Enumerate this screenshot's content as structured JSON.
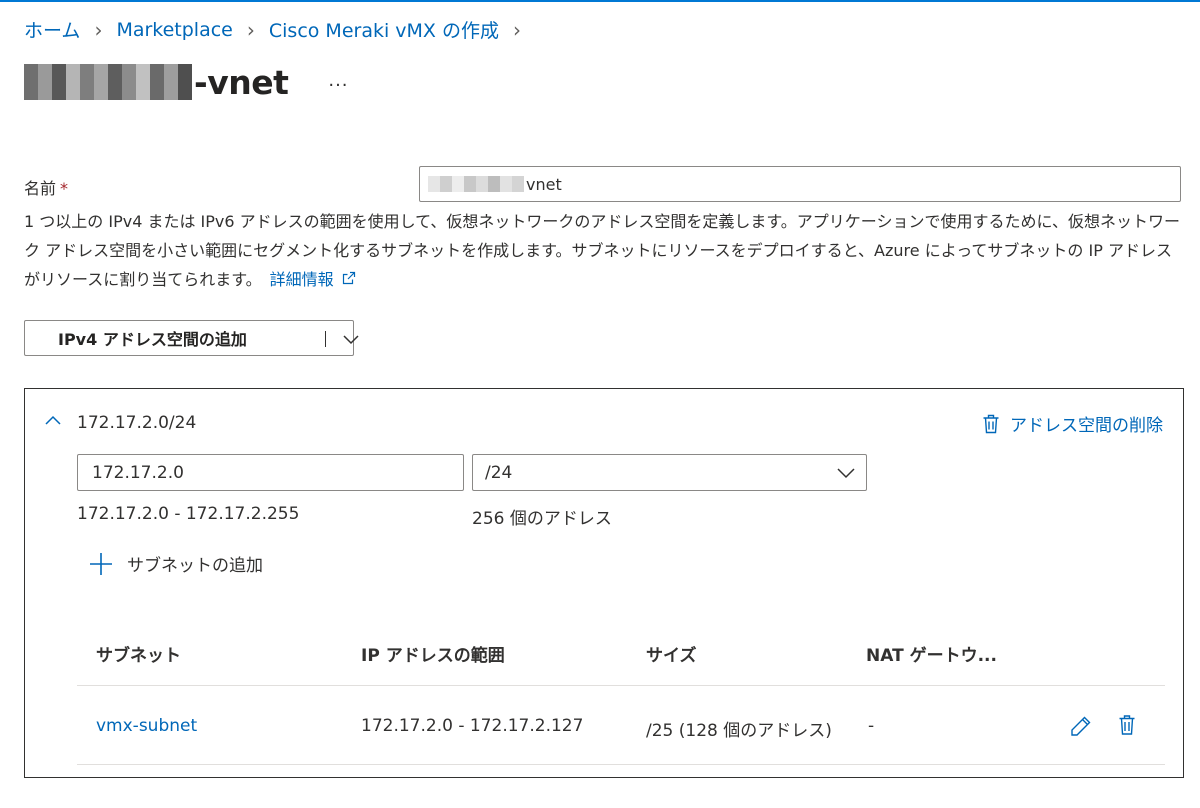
{
  "breadcrumb": {
    "items": [
      "ホーム",
      "Marketplace",
      "Cisco Meraki vMX の作成"
    ]
  },
  "page": {
    "title_suffix": "-vnet",
    "more_label": "···"
  },
  "form": {
    "name_label": "名前",
    "required_mark": "*",
    "name_value_suffix": "vnet",
    "description": "1 つ以上の IPv4 または IPv6 アドレスの範囲を使用して、仮想ネットワークのアドレス空間を定義します。アプリケーションで使用するために、仮想ネットワーク アドレス空間を小さい範囲にセグメント化するサブネットを作成します。サブネットにリソースをデプロイすると、Azure によってサブネットの IP アドレスがリソースに割り当てられます。",
    "learn_more": "詳細情報",
    "add_space_button": "IPv4 アドレス空間の追加"
  },
  "address_space": {
    "cidr": "172.17.2.0/24",
    "delete_label": "アドレス空間の削除",
    "address_value": "172.17.2.0",
    "prefix_value": "/24",
    "range": "172.17.2.0 - 172.17.2.255",
    "count": "256 個のアドレス",
    "add_subnet_label": "サブネットの追加"
  },
  "subnet_table": {
    "headers": [
      "サブネット",
      "IP アドレスの範囲",
      "サイズ",
      "NAT ゲートウ..."
    ],
    "rows": [
      {
        "name": "vmx-subnet",
        "range": "172.17.2.0 - 172.17.2.127",
        "size": "/25 (128 個のアドレス)",
        "nat": "-"
      }
    ]
  },
  "colors": {
    "accent": "#0078d4",
    "link": "#0067b8",
    "required": "#a4262c",
    "border": "#8a8886"
  },
  "icons": [
    "chevron-right-icon",
    "chevron-down-icon",
    "chevron-up-icon",
    "trash-icon",
    "plus-icon",
    "pencil-icon",
    "external-link-icon"
  ]
}
